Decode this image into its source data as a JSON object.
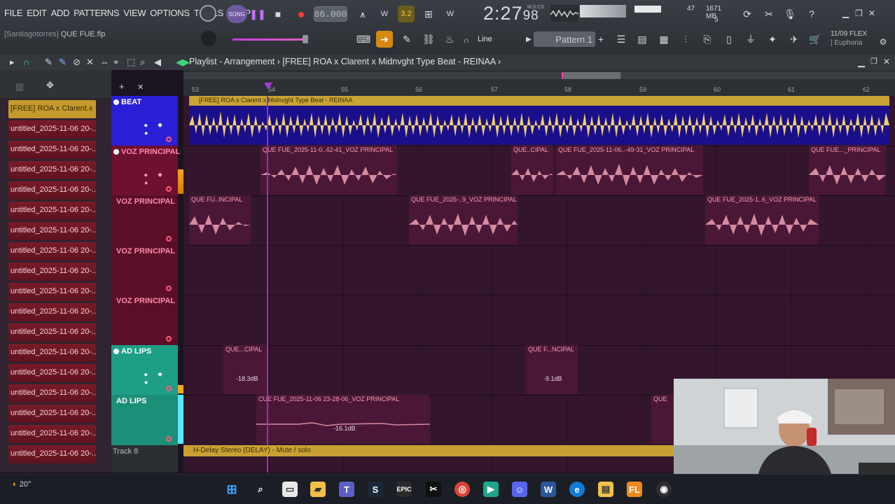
{
  "menu": [
    "FILE",
    "EDIT",
    "ADD",
    "PATTERNS",
    "VIEW",
    "OPTIONS",
    "TOOLS",
    "HELP"
  ],
  "project": {
    "user": "[Santiagotorres]",
    "file": "QUE FUE.flp"
  },
  "transport": {
    "mode": "SONG",
    "tempo": "86.000",
    "time_main": "2:27",
    "time_small": "98",
    "time_label": "M:S:CS",
    "step_badge": "3.2"
  },
  "monitor": {
    "cpu": "47",
    "memory": "1671 MB",
    "polyphony": "5"
  },
  "toolbar": {
    "snap": "Line",
    "pattern": "Pattern 1"
  },
  "news": {
    "line1": "11/09  FLEX",
    "line2": "| Euphoria"
  },
  "playlist": {
    "title": "Playlist - Arrangement",
    "song": "[FREE] ROA x Clarent x Midnvght Type Beat - REINAA"
  },
  "bars": [
    "53",
    "54",
    "55",
    "56",
    "57",
    "58",
    "59",
    "60",
    "61",
    "62"
  ],
  "picker": {
    "items": [
      "[FREE] ROA x Clarent...",
      "untitled_2025-11-06 20-...",
      "untitled_2025-11-06 20-...",
      "untitled_2025-11-06 20-...",
      "untitled_2025-11-06 20-...",
      "untitled_2025-11-06 20-...",
      "untitled_2025-11-06 20-...",
      "untitled_2025-11-06 20-...",
      "untitled_2025-11-06 20-...",
      "untitled_2025-11-06 20-...",
      "untitled_2025-11-06 20-...",
      "untitled_2025-11-06 20-...",
      "untitled_2025-11-06 20-...",
      "untitled_2025-11-06 20-...",
      "untitled_2025-11-06 20-...",
      "untitled_2025-11-06 20-...",
      "untitled_2025-11-06 20-...",
      "untitled_2025-11-06 20-..."
    ]
  },
  "tracks": [
    {
      "name": "BEAT",
      "color": "#2a1ed6"
    },
    {
      "name": "VOZ PRINCIPAL",
      "color": "#7a1430"
    },
    {
      "name": "VOZ PRINCIPAL",
      "color": "#7a1430"
    },
    {
      "name": "VOZ PRINCIPAL",
      "color": "#7a1430"
    },
    {
      "name": "VOZ PRINCIPAL",
      "color": "#7a1430"
    },
    {
      "name": "AD LIPS",
      "color": "#1f9e86"
    },
    {
      "name": "AD LIPS",
      "color": "#1f9e86"
    },
    {
      "name": "Track 8",
      "color": "#2b2f33"
    }
  ],
  "clips": {
    "beat": "[FREE] ROA x Clarent x Midnvght Type Beat - REINAA",
    "v1a": "QUE FUE_2025-11-0..42-41_VOZ PRINCIPAL",
    "v1b": "QUE..CIPAL",
    "v1c": "QUE FUE_2025-11-06..-49-31_VOZ PRINCIPAL",
    "v1d": "QUE FUE..._PRINCIPAL",
    "v2a": "QUE FU..INCIPAL",
    "v2b": "QUE FUE_2025-..9_VOZ PRINCIPAL",
    "v2c": "QUE FUE_2025-1..6_VOZ PRINCIPAL",
    "a1a": "QUE...CIPAL",
    "a1a_db": "-18.3dB",
    "a1b": "QUE F...NCIPAL",
    "a1b_db": "-9.1dB",
    "a2a": "CUE FUE_2025-11-06 23-28-06_VOZ PRINCIPAL",
    "a2a_db": "-16.1dB",
    "a2b": "QUE",
    "delay": "H-Delay Stereo (DELAY) - Mute / solo"
  },
  "taskbar": {
    "weather": "20°"
  },
  "colors": {
    "beat_clip": "#e8c46a",
    "vocal_clip": "#d48aa0",
    "accent": "#f5a623",
    "playhead": "#9b2cc9"
  }
}
